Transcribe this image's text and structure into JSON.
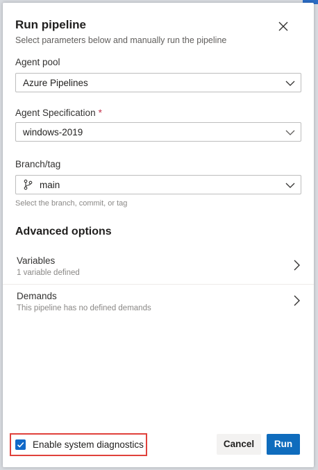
{
  "dialog": {
    "title": "Run pipeline",
    "subtitle": "Select parameters below and manually run the pipeline",
    "close_icon": "close-icon"
  },
  "fields": {
    "agent_pool": {
      "label": "Agent pool",
      "value": "Azure Pipelines"
    },
    "agent_spec": {
      "label": "Agent Specification",
      "required_marker": "*",
      "value": "windows-2019"
    },
    "branch": {
      "label": "Branch/tag",
      "value": "main",
      "hint": "Select the branch, commit, or tag",
      "icon": "branch-icon"
    }
  },
  "advanced": {
    "title": "Advanced options",
    "items": [
      {
        "title": "Variables",
        "subtitle": "1 variable defined"
      },
      {
        "title": "Demands",
        "subtitle": "This pipeline has no defined demands"
      }
    ]
  },
  "footer": {
    "diagnostics_label": "Enable system diagnostics",
    "diagnostics_checked": true,
    "cancel_label": "Cancel",
    "run_label": "Run"
  },
  "colors": {
    "accent": "#0f6cbd",
    "highlight_border": "#e0413b",
    "required": "#c4314b"
  }
}
